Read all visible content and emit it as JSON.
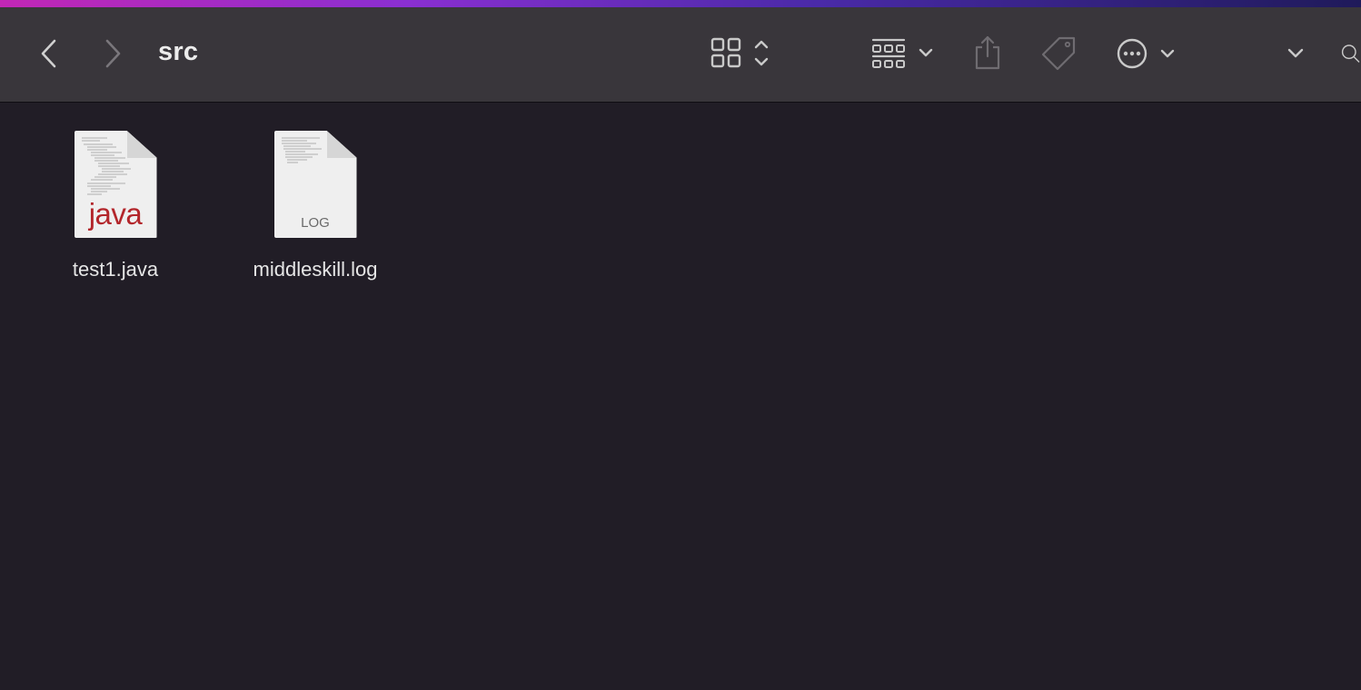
{
  "window": {
    "title": "src"
  },
  "toolbar": {
    "back": "back",
    "forward": "forward",
    "view_mode": "grid",
    "group": "group",
    "share": "share",
    "tags": "tags",
    "more_actions": "more"
  },
  "files": [
    {
      "name": "test1.java",
      "badge": "java",
      "type": "java-source"
    },
    {
      "name": "middleskill.log",
      "badge": "LOG",
      "type": "log-file"
    }
  ],
  "colors": {
    "window_bg": "#211d26",
    "toolbar_bg": "#39363b",
    "java_red": "#b3262b"
  }
}
